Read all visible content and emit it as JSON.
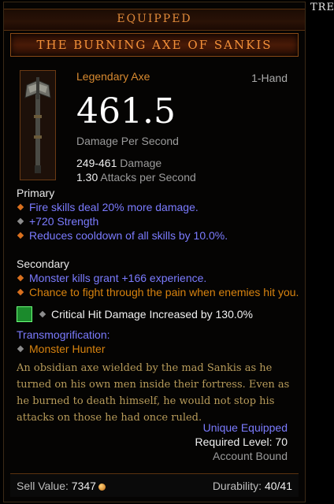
{
  "corner_text": "TRE",
  "header": {
    "equipped_label": "EQUIPPED",
    "item_name": "THE BURNING AXE OF SANKIS"
  },
  "item": {
    "type": "Legendary Axe",
    "slot": "1-Hand",
    "dps": "461.5",
    "dps_label": "Damage Per Second",
    "damage_range": "249-461",
    "damage_label": "Damage",
    "attack_speed": "1.30",
    "attack_speed_label": "Attacks per Second",
    "icon": "axe-icon"
  },
  "primary": {
    "heading": "Primary",
    "affixes": [
      {
        "text": "Fire skills deal 20% more damage.",
        "marker": "orange"
      },
      {
        "text": "+720 Strength",
        "marker": "gray"
      },
      {
        "text": "Reduces cooldown of all skills by 10.0%.",
        "marker": "orange"
      }
    ]
  },
  "secondary": {
    "heading": "Secondary",
    "affixes": [
      {
        "text": "Monster kills grant +166 experience.",
        "marker": "orange"
      },
      {
        "text": "Chance to fight through the pain when enemies hit you.",
        "marker": "orange"
      }
    ]
  },
  "gem": {
    "text": "Critical Hit Damage Increased by 130.0%",
    "icon": "emerald-gem-icon"
  },
  "transmog": {
    "heading": "Transmogrification:",
    "value": "Monster Hunter"
  },
  "flavor_lines": [
    "An obsidian axe wielded by the mad Sankis as he",
    "turned on his own men inside their fortress. Even as",
    "he burned to death himself, he would not stop his",
    "attacks on those he had once ruled."
  ],
  "meta": {
    "unique_equipped": "Unique Equipped",
    "required_level": "Required Level: 70",
    "account_bound": "Account Bound"
  },
  "footer": {
    "sell_label": "Sell Value:",
    "sell_value": "7347",
    "durability_label": "Durability:",
    "durability_value": "40/41"
  },
  "colors": {
    "legendary": "#d88a30",
    "magic_affix": "#7b7bff",
    "secondary_affix": "#d8830f",
    "flavor": "#b79b5a"
  }
}
